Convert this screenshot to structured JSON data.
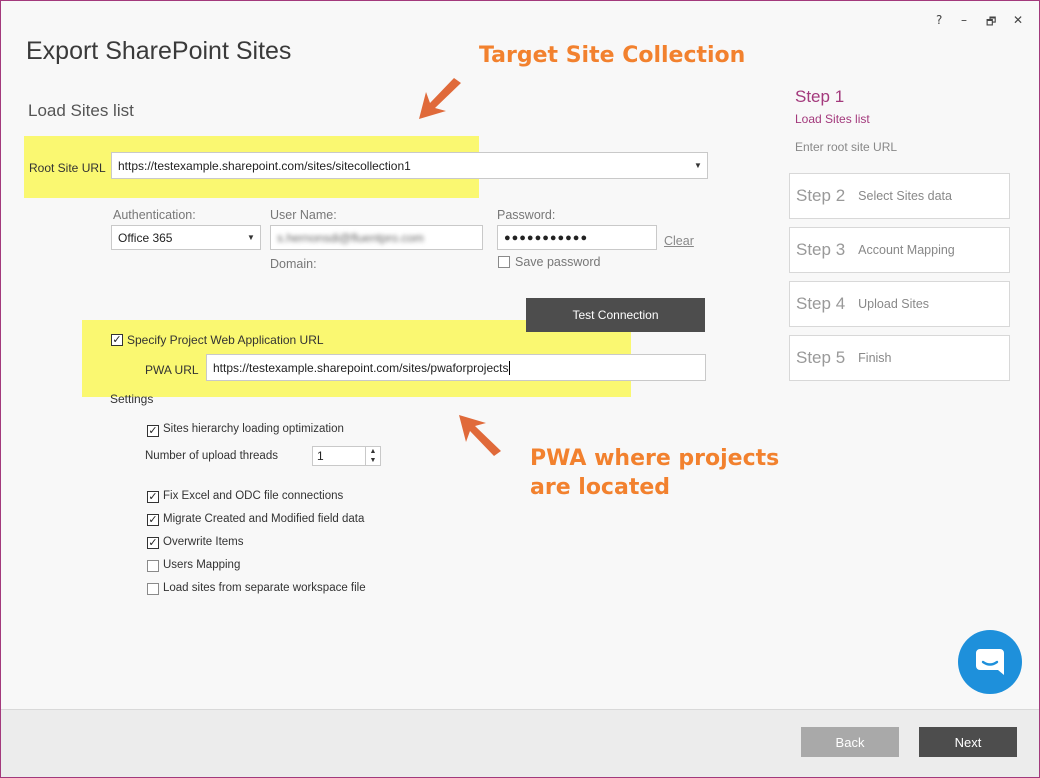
{
  "window": {
    "controls": {
      "help": "?",
      "minimize": "–",
      "restore": "🗗",
      "close": "✕"
    },
    "title": "Export SharePoint Sites",
    "subtitle": "Load Sites list"
  },
  "annotations": {
    "target": "Target Site Collection",
    "pwa_line1": "PWA where projects",
    "pwa_line2": "are located",
    "color": "#f2812e",
    "arrow_color": "#e06a3a",
    "highlight_color": "#faf871"
  },
  "form": {
    "root_url_label": "Root Site URL",
    "root_url_value": "https://testexample.sharepoint.com/sites/sitecollection1",
    "auth_label": "Authentication:",
    "auth_value": "Office 365",
    "username_label": "User Name:",
    "username_value": "s.hernonsdi@fluentpro.com",
    "domain_label": "Domain:",
    "password_label": "Password:",
    "password_value": "●●●●●●●●●●●",
    "clear_link": "Clear",
    "save_password_label": "Save password",
    "save_password_checked": false,
    "test_connection": "Test Connection",
    "pwa_checkbox_label": "Specify Project Web Application URL",
    "pwa_checked": true,
    "pwa_url_label": "PWA URL",
    "pwa_url_value": "https://testexample.sharepoint.com/sites/pwaforprojects"
  },
  "settings": {
    "heading": "Settings",
    "hierarchy_opt": {
      "label": "Sites hierarchy loading optimization",
      "checked": true
    },
    "threads_label": "Number of upload threads",
    "threads_value": "1",
    "fix_excel": {
      "label": "Fix Excel and ODC file connections",
      "checked": true
    },
    "migrate_created": {
      "label": "Migrate Created and Modified field data",
      "checked": true
    },
    "overwrite": {
      "label": "Overwrite Items",
      "checked": true
    },
    "users_mapping": {
      "label": "Users Mapping",
      "checked": false
    },
    "load_workspace": {
      "label": "Load sites from separate workspace file",
      "checked": false
    }
  },
  "steps": {
    "current": {
      "num": "Step 1",
      "name": "Load Sites list",
      "hint": "Enter root site URL",
      "color": "#a3397c"
    },
    "items": [
      {
        "num": "Step 2",
        "name": "Select Sites data"
      },
      {
        "num": "Step 3",
        "name": "Account Mapping"
      },
      {
        "num": "Step 4",
        "name": "Upload Sites"
      },
      {
        "num": "Step 5",
        "name": "Finish"
      }
    ]
  },
  "footer": {
    "back": "Back",
    "next": "Next",
    "back_color": "#a9a9a9",
    "next_color": "#4d4d4d"
  },
  "chat": {
    "icon": "chat-bubble-icon",
    "color": "#1e90db"
  }
}
